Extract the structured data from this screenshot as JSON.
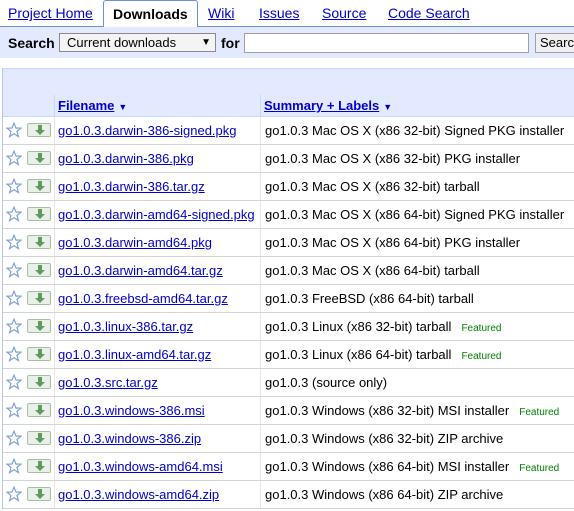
{
  "tabs": [
    {
      "label": "Project Home",
      "active": false
    },
    {
      "label": "Downloads",
      "active": true
    },
    {
      "label": "Wiki",
      "active": false
    },
    {
      "label": "Issues",
      "active": false
    },
    {
      "label": "Source",
      "active": false
    },
    {
      "label": "Code Search",
      "active": false
    }
  ],
  "search": {
    "label": "Search",
    "scope_value": "Current downloads",
    "for_label": "for",
    "query_value": "",
    "button_label": "Search"
  },
  "table": {
    "columns": {
      "filename": "Filename",
      "summary": "Summary + Labels"
    },
    "featured_label": "Featured",
    "rows": [
      {
        "filename": "go1.0.3.darwin-386-signed.pkg",
        "summary": "go1.0.3 Mac OS X (x86 32-bit) Signed PKG installer",
        "featured": false
      },
      {
        "filename": "go1.0.3.darwin-386.pkg",
        "summary": "go1.0.3 Mac OS X (x86 32-bit) PKG installer",
        "featured": false
      },
      {
        "filename": "go1.0.3.darwin-386.tar.gz",
        "summary": "go1.0.3 Mac OS X (x86 32-bit) tarball",
        "featured": false
      },
      {
        "filename": "go1.0.3.darwin-amd64-signed.pkg",
        "summary": "go1.0.3 Mac OS X (x86 64-bit) Signed PKG installer",
        "featured": false
      },
      {
        "filename": "go1.0.3.darwin-amd64.pkg",
        "summary": "go1.0.3 Mac OS X (x86 64-bit) PKG installer",
        "featured": false
      },
      {
        "filename": "go1.0.3.darwin-amd64.tar.gz",
        "summary": "go1.0.3 Mac OS X (x86 64-bit) tarball",
        "featured": false
      },
      {
        "filename": "go1.0.3.freebsd-amd64.tar.gz",
        "summary": "go1.0.3 FreeBSD (x86 64-bit) tarball",
        "featured": false
      },
      {
        "filename": "go1.0.3.linux-386.tar.gz",
        "summary": "go1.0.3 Linux (x86 32-bit) tarball",
        "featured": true
      },
      {
        "filename": "go1.0.3.linux-amd64.tar.gz",
        "summary": "go1.0.3 Linux (x86 64-bit) tarball",
        "featured": true
      },
      {
        "filename": "go1.0.3.src.tar.gz",
        "summary": "go1.0.3 (source only)",
        "featured": false
      },
      {
        "filename": "go1.0.3.windows-386.msi",
        "summary": "go1.0.3 Windows (x86 32-bit) MSI installer",
        "featured": true
      },
      {
        "filename": "go1.0.3.windows-386.zip",
        "summary": "go1.0.3 Windows (x86 32-bit) ZIP archive",
        "featured": false
      },
      {
        "filename": "go1.0.3.windows-amd64.msi",
        "summary": "go1.0.3 Windows (x86 64-bit) MSI installer",
        "featured": true
      },
      {
        "filename": "go1.0.3.windows-amd64.zip",
        "summary": "go1.0.3 Windows (x86 64-bit) ZIP archive",
        "featured": false
      }
    ]
  },
  "icons": {
    "star": "star-outline-icon",
    "download": "download-arrow-icon",
    "dropdown": "chevron-down-icon",
    "sort": "sort-down-icon"
  },
  "colors": {
    "link": "#0000cc",
    "header_bg": "#e3e9ff",
    "tab_border": "#6b90da",
    "featured": "#008000"
  }
}
